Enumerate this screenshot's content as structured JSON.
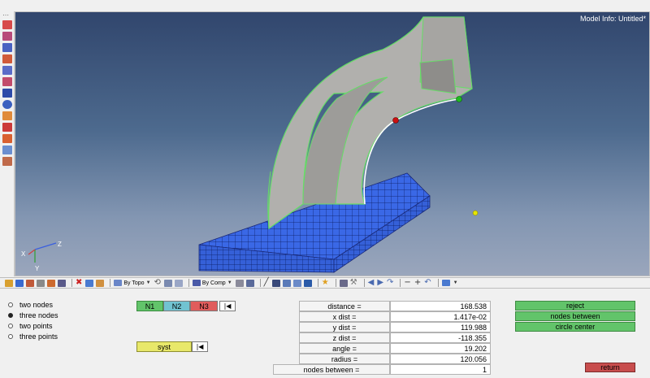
{
  "viewport": {
    "model_info": "Model Info: Untitled*"
  },
  "axes": {
    "x": "X",
    "y": "Y",
    "z": "Z"
  },
  "toolbar": {
    "dropdowns": [
      {
        "name": "topo-dropdown",
        "label": "By Topo"
      },
      {
        "name": "comp-dropdown",
        "label": "By Comp"
      }
    ]
  },
  "panel": {
    "radio_options": [
      {
        "label": "two nodes",
        "selected": false
      },
      {
        "label": "three nodes",
        "selected": true
      },
      {
        "label": "two points",
        "selected": false
      },
      {
        "label": "three points",
        "selected": false
      }
    ],
    "node_buttons": [
      "N1",
      "N2",
      "N3"
    ],
    "reset_glyph": "|◀",
    "system_label": "syst",
    "measurements": [
      {
        "label": "distance =",
        "value": "168.538"
      },
      {
        "label": "x dist =",
        "value": "1.417e-02"
      },
      {
        "label": "y dist =",
        "value": "119.988"
      },
      {
        "label": "z dist =",
        "value": "-118.355"
      },
      {
        "label": "angle =",
        "value": "19.202"
      },
      {
        "label": "radius =",
        "value": "120.056"
      },
      {
        "label": "nodes between =",
        "value": "1"
      }
    ],
    "actions": [
      "reject",
      "nodes between",
      "circle center"
    ],
    "return_label": "return"
  },
  "colors": {
    "viewport_top": "#31466d",
    "viewport_bottom": "#9aa6bc",
    "mesh_blue": "#3a68e6",
    "surface_gray": "#b1b0ad",
    "edge_green": "#66dd66",
    "node_red": "#cc1111",
    "node_green": "#22bb22",
    "point_yellow": "#e6e600",
    "n1": "#62c46a",
    "n2": "#71c3d1",
    "n3": "#e05c5c",
    "action_green": "#62c46a",
    "return_red": "#c84d4d"
  }
}
